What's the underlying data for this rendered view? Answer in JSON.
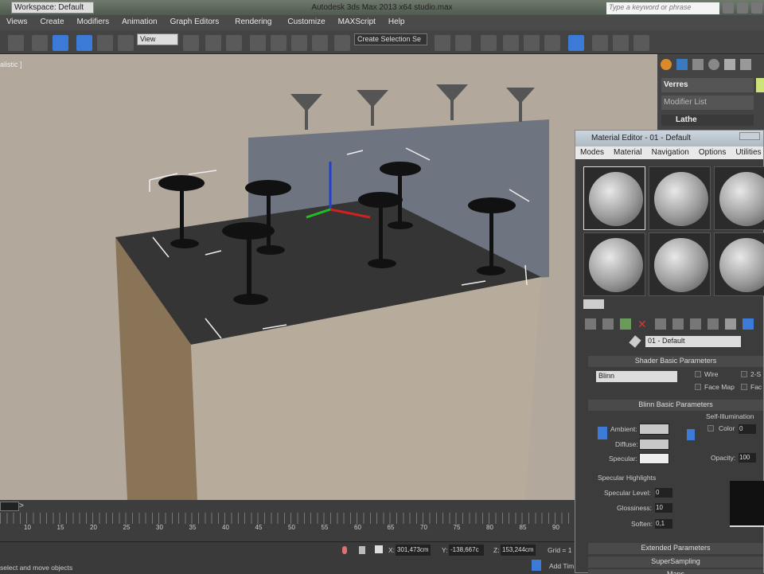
{
  "titlebar": {
    "workspace": "Workspace: Default",
    "title": "Autodesk 3ds Max  2013 x64     studio.max",
    "search_placeholder": "Type a keyword or phrase"
  },
  "menu": [
    "Views",
    "Create",
    "Modifiers",
    "Animation",
    "Graph Editors",
    "Rendering",
    "Customize",
    "MAXScript",
    "Help"
  ],
  "toolbar": {
    "ref_coord": "View",
    "selection_set": "Create Selection Se"
  },
  "viewport": {
    "label": "alistic ]"
  },
  "command_panel": {
    "object_name": "Verres",
    "modifier_list": "Modifier List",
    "stack_item": "Lathe"
  },
  "material_editor": {
    "title": "Material Editor - 01 - Default",
    "menu": [
      "Modes",
      "Material",
      "Navigation",
      "Options",
      "Utilities"
    ],
    "material_name": "01 - Default",
    "shader_rollout": "Shader Basic Parameters",
    "shader": "Blinn",
    "wire": "Wire",
    "two_sided": "2-S",
    "face_map": "Face Map",
    "faceted": "Fac",
    "blinn_rollout": "Blinn Basic Parameters",
    "self_illum": "Self-Illumination",
    "color": "Color",
    "color_value": "0",
    "ambient": "Ambient:",
    "diffuse": "Diffuse:",
    "specular": "Specular:",
    "opacity": "Opacity:",
    "opacity_value": "100",
    "spec_highlights": "Specular Highlights",
    "spec_level": "Specular Level:",
    "spec_level_value": "0",
    "glossiness": "Glossiness:",
    "glossiness_value": "10",
    "soften": "Soften:",
    "soften_value": "0,1",
    "extended": "Extended Parameters",
    "supersampling": "SuperSampling",
    "maps": "Maps"
  },
  "timeline": {
    "ticks": [
      "10",
      "15",
      "20",
      "25",
      "30",
      "35",
      "40",
      "45",
      "50",
      "55",
      "60",
      "65",
      "70",
      "75",
      "80",
      "85",
      "90"
    ]
  },
  "status": {
    "prompt": "select and move objects",
    "x": "301,473cm",
    "y": "-138,667c",
    "z": "153,244cm",
    "grid": "Grid = 1",
    "x_label": "X:",
    "y_label": "Y:",
    "z_label": "Z:",
    "add_time": "Add Tim"
  }
}
